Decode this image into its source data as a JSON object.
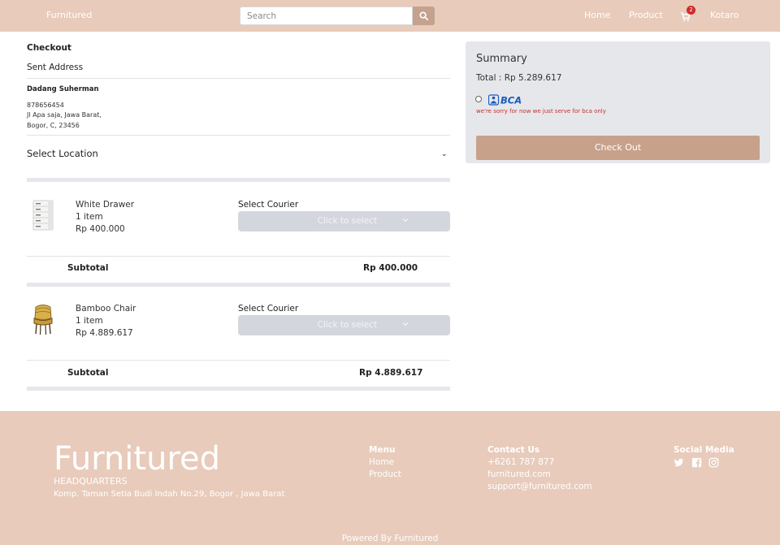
{
  "navbar": {
    "brand": "Furnitured",
    "search_placeholder": "Search",
    "links": {
      "home": "Home",
      "product": "Product",
      "user": "Kotaro"
    },
    "cart_count": "2"
  },
  "checkout": {
    "title": "Checkout",
    "sent_address_label": "Sent Address",
    "recipient_name": "Dadang Suherman",
    "phone": "878656454",
    "address_line1": "Jl Apa saja, Jawa Barat,",
    "address_line2": "Bogor, C, 23456",
    "select_location_label": "Select Location"
  },
  "items": [
    {
      "name": "White Drawer",
      "qty": "1 item",
      "price": "Rp 400.000",
      "courier_label": "Select Courier",
      "courier_placeholder": "Click to select",
      "subtotal_label": "Subtotal",
      "subtotal_value": "Rp 400.000"
    },
    {
      "name": "Bamboo Chair",
      "qty": "1 item",
      "price": "Rp 4.889.617",
      "courier_label": "Select Courier",
      "courier_placeholder": "Click to select",
      "subtotal_label": "Subtotal",
      "subtotal_value": "Rp 4.889.617"
    }
  ],
  "summary": {
    "title": "Summary",
    "total": "Total : Rp 5.289.617",
    "bank_logo_text": "BCA",
    "bank_note": "we're sorry for now we just serve for bca only",
    "checkout_button": "Check Out"
  },
  "footer": {
    "brand": "Furnitured",
    "hq_label": "HEADQUARTERS",
    "hq_address": "Komp. Taman Setia Budi Indah No.29, Bogor , Jawa Barat",
    "menu_title": "Menu",
    "menu_items": [
      "Home",
      "Product"
    ],
    "contact_title": "Contact Us",
    "contact_items": [
      "+6261 787 877",
      "furnitured.com",
      "support@furnitured.com"
    ],
    "social_title": "Social Media",
    "social_icons": [
      "twitter-icon",
      "facebook-icon",
      "instagram-icon"
    ],
    "powered_by": "Powered By Furnitured"
  },
  "colors": {
    "nav_bg": "#e8cbbb",
    "accent": "#c8a18b",
    "panel_bg": "#e5e7eb",
    "error": "#c53030",
    "badge": "#d12a2a",
    "bca_blue": "#1a5bbf"
  }
}
